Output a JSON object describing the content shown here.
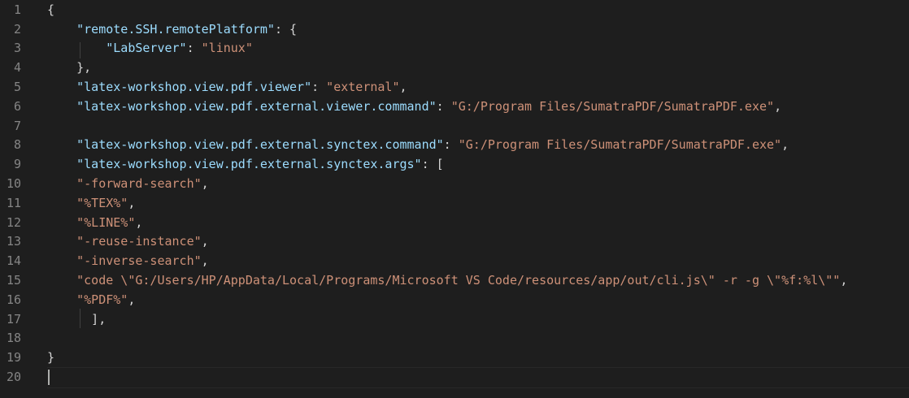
{
  "editor": {
    "line_numbers": [
      "1",
      "2",
      "3",
      "4",
      "5",
      "6",
      "7",
      "8",
      "9",
      "10",
      "11",
      "12",
      "13",
      "14",
      "15",
      "16",
      "17",
      "18",
      "19",
      "20"
    ],
    "lines": [
      [
        {
          "t": "{",
          "c": "p"
        }
      ],
      [
        {
          "t": "    ",
          "c": "p"
        },
        {
          "t": "\"remote.SSH.remotePlatform\"",
          "c": "k"
        },
        {
          "t": ": {",
          "c": "p"
        }
      ],
      [
        {
          "t": "        ",
          "c": "p"
        },
        {
          "t": "\"LabServer\"",
          "c": "k"
        },
        {
          "t": ": ",
          "c": "p"
        },
        {
          "t": "\"linux\"",
          "c": "s"
        }
      ],
      [
        {
          "t": "    },",
          "c": "p"
        }
      ],
      [
        {
          "t": "    ",
          "c": "p"
        },
        {
          "t": "\"latex-workshop.view.pdf.viewer\"",
          "c": "k"
        },
        {
          "t": ": ",
          "c": "p"
        },
        {
          "t": "\"external\"",
          "c": "s"
        },
        {
          "t": ",",
          "c": "p"
        }
      ],
      [
        {
          "t": "    ",
          "c": "p"
        },
        {
          "t": "\"latex-workshop.view.pdf.external.viewer.command\"",
          "c": "k"
        },
        {
          "t": ": ",
          "c": "p"
        },
        {
          "t": "\"G:/Program Files/SumatraPDF/SumatraPDF.exe\"",
          "c": "s"
        },
        {
          "t": ",",
          "c": "p"
        }
      ],
      [],
      [
        {
          "t": "    ",
          "c": "p"
        },
        {
          "t": "\"latex-workshop.view.pdf.external.synctex.command\"",
          "c": "k"
        },
        {
          "t": ": ",
          "c": "p"
        },
        {
          "t": "\"G:/Program Files/SumatraPDF/SumatraPDF.exe\"",
          "c": "s"
        },
        {
          "t": ",",
          "c": "p"
        }
      ],
      [
        {
          "t": "    ",
          "c": "p"
        },
        {
          "t": "\"latex-workshop.view.pdf.external.synctex.args\"",
          "c": "k"
        },
        {
          "t": ": [",
          "c": "p"
        }
      ],
      [
        {
          "t": "    ",
          "c": "p"
        },
        {
          "t": "\"-forward-search\"",
          "c": "s"
        },
        {
          "t": ",",
          "c": "p"
        }
      ],
      [
        {
          "t": "    ",
          "c": "p"
        },
        {
          "t": "\"%TEX%\"",
          "c": "s"
        },
        {
          "t": ",",
          "c": "p"
        }
      ],
      [
        {
          "t": "    ",
          "c": "p"
        },
        {
          "t": "\"%LINE%\"",
          "c": "s"
        },
        {
          "t": ",",
          "c": "p"
        }
      ],
      [
        {
          "t": "    ",
          "c": "p"
        },
        {
          "t": "\"-reuse-instance\"",
          "c": "s"
        },
        {
          "t": ",",
          "c": "p"
        }
      ],
      [
        {
          "t": "    ",
          "c": "p"
        },
        {
          "t": "\"-inverse-search\"",
          "c": "s"
        },
        {
          "t": ",",
          "c": "p"
        }
      ],
      [
        {
          "t": "    ",
          "c": "p"
        },
        {
          "t": "\"code \\\"G:/Users/HP/AppData/Local/Programs/Microsoft VS Code/resources/app/out/cli.js\\\" -r -g \\\"%f:%l\\\"\"",
          "c": "s"
        },
        {
          "t": ",",
          "c": "p"
        }
      ],
      [
        {
          "t": "    ",
          "c": "p"
        },
        {
          "t": "\"%PDF%\"",
          "c": "s"
        },
        {
          "t": ",",
          "c": "p"
        }
      ],
      [
        {
          "t": "      ],",
          "c": "p"
        }
      ],
      [],
      [
        {
          "t": "}",
          "c": "p"
        }
      ],
      []
    ]
  },
  "colors": {
    "background": "#1e1e1e",
    "line_number": "#858585",
    "key": "#9cdcfe",
    "string": "#ce9178",
    "punctuation": "#d4d4d4"
  }
}
